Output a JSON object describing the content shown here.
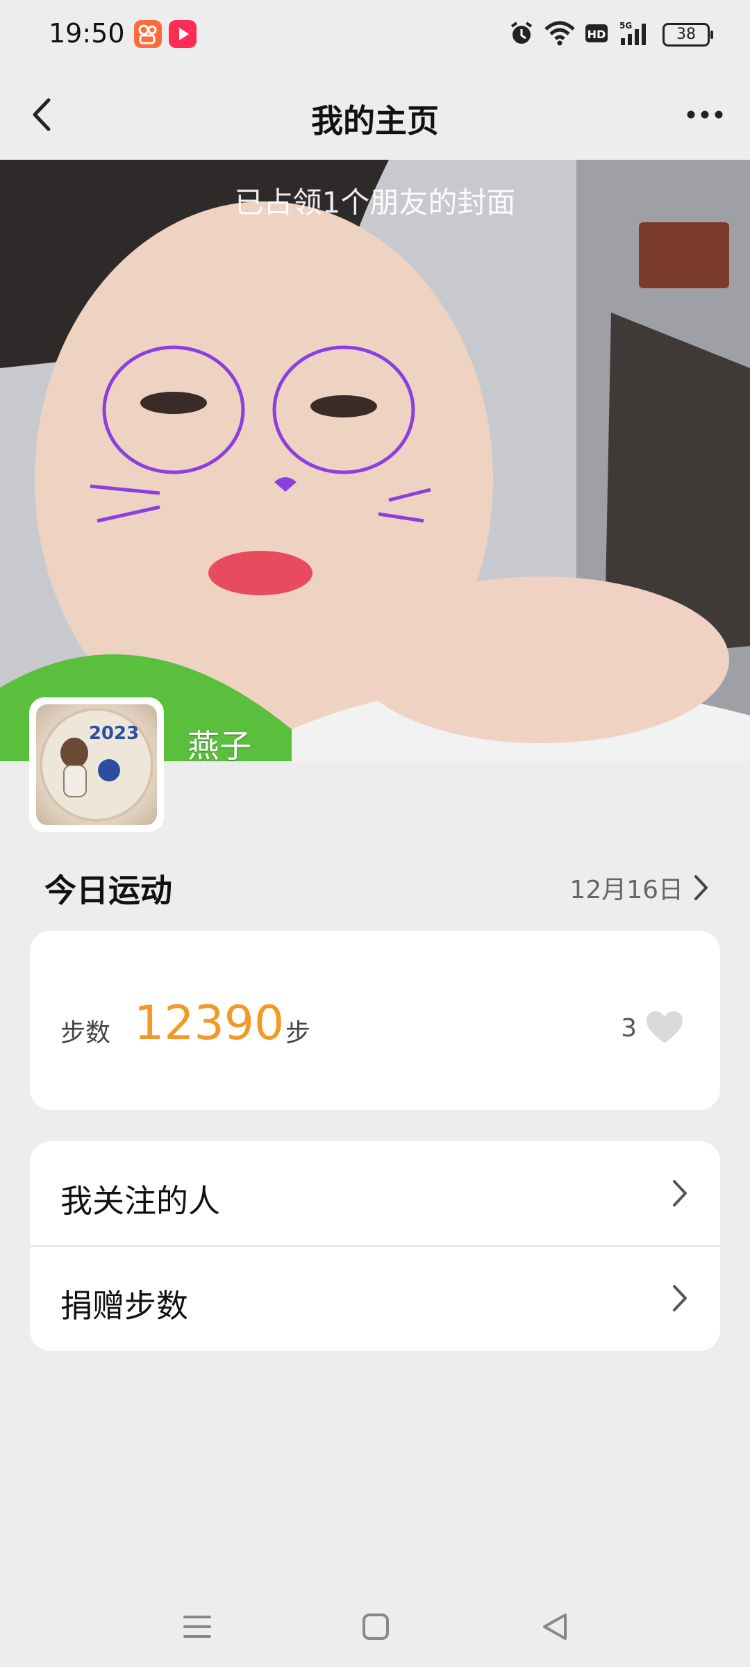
{
  "status_bar": {
    "time": "19:50",
    "apps": [
      "kuaishou-icon",
      "video-app-icon"
    ],
    "icons": [
      "alarm-icon",
      "wifi-icon",
      "hd-icon",
      "5g-signal-icon"
    ],
    "battery": "38"
  },
  "header": {
    "title": "我的主页",
    "back_icon": "chevron-left-icon",
    "more_icon": "more-dots-icon"
  },
  "cover": {
    "note": "已占领1个朋友的封面",
    "nickname": "燕子"
  },
  "today": {
    "title": "今日运动",
    "date": "12月16日",
    "steps_label": "步数",
    "steps_value": "12390",
    "steps_unit": "步",
    "likes": "3",
    "accent_color": "#f39a26"
  },
  "menu": {
    "items": [
      {
        "label": "我关注的人"
      },
      {
        "label": "捐赠步数"
      }
    ]
  },
  "nav_bar": {
    "icons": [
      "menu-icon",
      "home-icon",
      "back-icon"
    ]
  }
}
